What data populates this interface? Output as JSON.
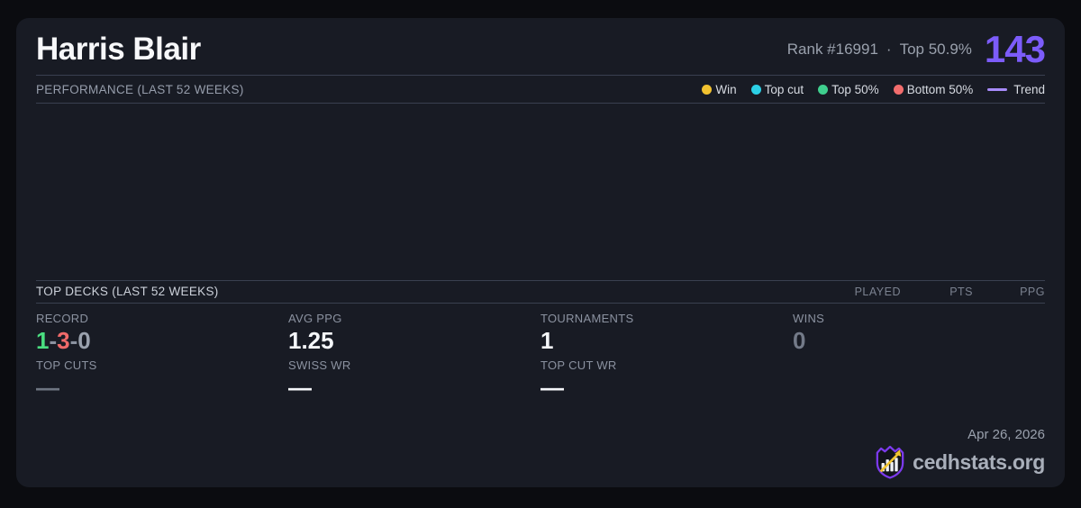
{
  "colors": {
    "accent_purple": "#7c5cfa",
    "trend_purple": "#a78bfa",
    "win_yellow": "#f2c230",
    "topcut_cyan": "#2cd0e6",
    "top50_green": "#3fcf8e",
    "bottom50_red": "#f26d6d",
    "record_win_green": "#4ade80",
    "record_loss_red": "#ef6a6a",
    "record_draw_gray": "#9aa1ad"
  },
  "header": {
    "player_name": "Harris Blair",
    "rank_text": "Rank #16991",
    "dot_separator": "·",
    "top_percent_text": "Top 50.9%",
    "rating": "143"
  },
  "performance": {
    "title": "PERFORMANCE (LAST 52 WEEKS)",
    "legend": [
      {
        "label": "Win",
        "color": "#f2c230"
      },
      {
        "label": "Top cut",
        "color": "#2cd0e6"
      },
      {
        "label": "Top 50%",
        "color": "#3fcf8e"
      },
      {
        "label": "Bottom 50%",
        "color": "#f26d6d"
      },
      {
        "label": "Trend",
        "color": "#a78bfa"
      }
    ]
  },
  "chart_data": {
    "type": "scatter",
    "title": "PERFORMANCE (LAST 52 WEEKS)",
    "points": [],
    "legend_entries": [
      "Win",
      "Top cut",
      "Top 50%",
      "Bottom 50%",
      "Trend"
    ],
    "legend_position": "top-right",
    "grid": false,
    "note": "plot area is rendered empty - no visible data points"
  },
  "top_decks": {
    "title": "TOP DECKS (LAST 52 WEEKS)",
    "columns": [
      "PLAYED",
      "PTS",
      "PPG"
    ]
  },
  "stats": {
    "record": {
      "label": "RECORD",
      "wins": "1",
      "losses": "3",
      "draws": "0",
      "separator": "-"
    },
    "avg_ppg": {
      "label": "AVG PPG",
      "value": "1.25"
    },
    "tournaments": {
      "label": "TOURNAMENTS",
      "value": "1"
    },
    "wins": {
      "label": "WINS",
      "value": "0"
    },
    "top_cuts": {
      "label": "TOP CUTS",
      "value": "—"
    },
    "swiss_wr": {
      "label": "SWISS WR",
      "value": "—"
    },
    "top_cut_wr": {
      "label": "TOP CUT WR",
      "value": "—"
    }
  },
  "footer": {
    "date": "Apr 26, 2026",
    "site_name": "cedhstats.org",
    "logo": "cedhstats-shield-logo"
  }
}
